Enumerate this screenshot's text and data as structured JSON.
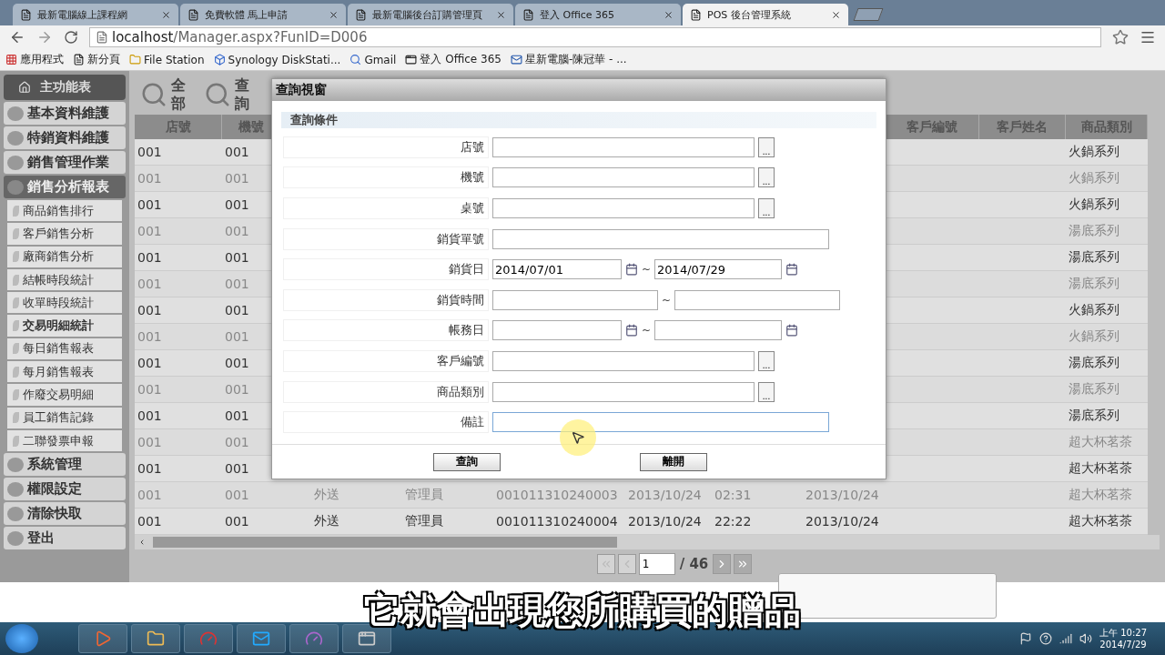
{
  "browser": {
    "tabs": [
      {
        "title": "最新電腦線上課程網",
        "selected": false
      },
      {
        "title": "免費軟體 馬上申請",
        "selected": false
      },
      {
        "title": "最新電腦後台訂購管理頁",
        "selected": false
      },
      {
        "title": "登入 Office 365",
        "selected": false
      },
      {
        "title": "POS 後台管理系統",
        "selected": true
      }
    ],
    "address": {
      "host": "localhost",
      "path": "/Manager.aspx?FunID=D006"
    },
    "bookmarks": [
      {
        "label": "應用程式",
        "kind": "apps"
      },
      {
        "label": "新分頁",
        "kind": "page"
      },
      {
        "label": "File Station",
        "kind": "folder"
      },
      {
        "label": "Synology DiskStati...",
        "kind": "dsm"
      },
      {
        "label": "Gmail",
        "kind": "google"
      },
      {
        "label": "登入 Office 365",
        "kind": "office"
      },
      {
        "label": "星新電腦-陳冠華 - ...",
        "kind": "outlook"
      }
    ]
  },
  "sidebar": {
    "title": "主功能表",
    "groups": [
      {
        "label": "基本資料維護",
        "expanded": false
      },
      {
        "label": "特銷資料維護",
        "expanded": false
      },
      {
        "label": "銷售管理作業",
        "expanded": false
      },
      {
        "label": "銷售分析報表",
        "expanded": true,
        "children": [
          {
            "label": "商品銷售排行",
            "selected": false
          },
          {
            "label": "客戶銷售分析",
            "selected": false
          },
          {
            "label": "廠商銷售分析",
            "selected": false
          },
          {
            "label": "結帳時段統計",
            "selected": false
          },
          {
            "label": "收單時段統計",
            "selected": false
          },
          {
            "label": "交易明細統計",
            "selected": true
          },
          {
            "label": "每日銷售報表",
            "selected": false
          },
          {
            "label": "每月銷售報表",
            "selected": false
          },
          {
            "label": "作廢交易明細",
            "selected": false
          },
          {
            "label": "員工銷售記錄",
            "selected": false
          },
          {
            "label": "二聯發票申報",
            "selected": false
          }
        ]
      },
      {
        "label": "系統管理",
        "expanded": false
      },
      {
        "label": "權限設定",
        "expanded": false
      },
      {
        "label": "清除快取",
        "expanded": false
      },
      {
        "label": "登出",
        "expanded": false
      }
    ]
  },
  "toolbar": [
    {
      "label_top": "全",
      "label_bottom": "部"
    },
    {
      "label_top": "查",
      "label_bottom": "詢"
    }
  ],
  "table": {
    "columns_left": [
      "店號",
      "機號"
    ],
    "columns_right": [
      "客戶編號",
      "客戶姓名",
      "商品類別"
    ],
    "rows": [
      {
        "kind": "partial",
        "cells": [
          "001",
          "001",
          "火鍋系列"
        ]
      },
      {
        "kind": "partial",
        "cells": [
          "001",
          "001",
          "火鍋系列"
        ]
      },
      {
        "kind": "partial",
        "cells": [
          "001",
          "001",
          "火鍋系列"
        ]
      },
      {
        "kind": "partial",
        "cells": [
          "001",
          "001",
          "湯底系列"
        ]
      },
      {
        "kind": "partial",
        "cells": [
          "001",
          "001",
          "湯底系列"
        ]
      },
      {
        "kind": "partial",
        "cells": [
          "001",
          "001",
          "湯底系列"
        ]
      },
      {
        "kind": "partial",
        "cells": [
          "001",
          "001",
          "火鍋系列"
        ]
      },
      {
        "kind": "partial",
        "cells": [
          "001",
          "001",
          "火鍋系列"
        ]
      },
      {
        "kind": "partial",
        "cells": [
          "001",
          "001",
          "湯底系列"
        ]
      },
      {
        "kind": "partial",
        "cells": [
          "001",
          "001",
          "湯底系列"
        ]
      },
      {
        "kind": "partial",
        "cells": [
          "001",
          "001",
          "湯底系列"
        ]
      },
      {
        "kind": "partial",
        "cells": [
          "001",
          "001",
          "超大杯茗茶"
        ]
      },
      {
        "kind": "partial",
        "cells": [
          "001",
          "001",
          "超大杯茗茶"
        ]
      },
      {
        "kind": "full",
        "cells": [
          "001",
          "001",
          "外送",
          "管理員",
          "001011310240003",
          "2013/10/24",
          "02:31",
          "2013/10/24",
          "超大杯茗茶"
        ]
      },
      {
        "kind": "full",
        "cells": [
          "001",
          "001",
          "外送",
          "管理員",
          "001011310240004",
          "2013/10/24",
          "22:22",
          "2013/10/24",
          "超大杯茗茶"
        ]
      }
    ]
  },
  "pager": {
    "buttons": [
      {
        "kind": "first",
        "disabled": true
      },
      {
        "kind": "prev",
        "disabled": true
      },
      {
        "kind": "next",
        "disabled": false
      },
      {
        "kind": "last",
        "disabled": false
      }
    ],
    "page": "1",
    "total": "/ 46"
  },
  "dialog": {
    "title": "查詢視窗",
    "section": "查詢條件",
    "fields": [
      {
        "label": "店號",
        "kind": "lookup"
      },
      {
        "label": "機號",
        "kind": "lookup"
      },
      {
        "label": "桌號",
        "kind": "lookup"
      },
      {
        "label": "銷貨單號",
        "kind": "text"
      },
      {
        "label": "銷貨日",
        "kind": "date_range",
        "from": "2014/07/01",
        "to": "2014/07/29",
        "separator": "~"
      },
      {
        "label": "銷貨時間",
        "kind": "text_range",
        "separator": "~"
      },
      {
        "label": "帳務日",
        "kind": "date_range",
        "separator": "~"
      },
      {
        "label": "客戶編號",
        "kind": "lookup"
      },
      {
        "label": "商品類別",
        "kind": "lookup"
      },
      {
        "label": "備註",
        "kind": "text",
        "focused": true
      }
    ],
    "lookup_button": "...",
    "buttons": [
      "查詢",
      "離開"
    ]
  },
  "subtitle": "它就會出現您所購買的贈品",
  "taskbar": {
    "apps": [
      {
        "kind": "media"
      },
      {
        "kind": "folder"
      },
      {
        "kind": "chrome"
      },
      {
        "kind": "skype"
      },
      {
        "kind": "gauge"
      },
      {
        "kind": "window"
      }
    ],
    "clock": {
      "time": "上午 10:27",
      "date": "2014/7/29"
    }
  }
}
